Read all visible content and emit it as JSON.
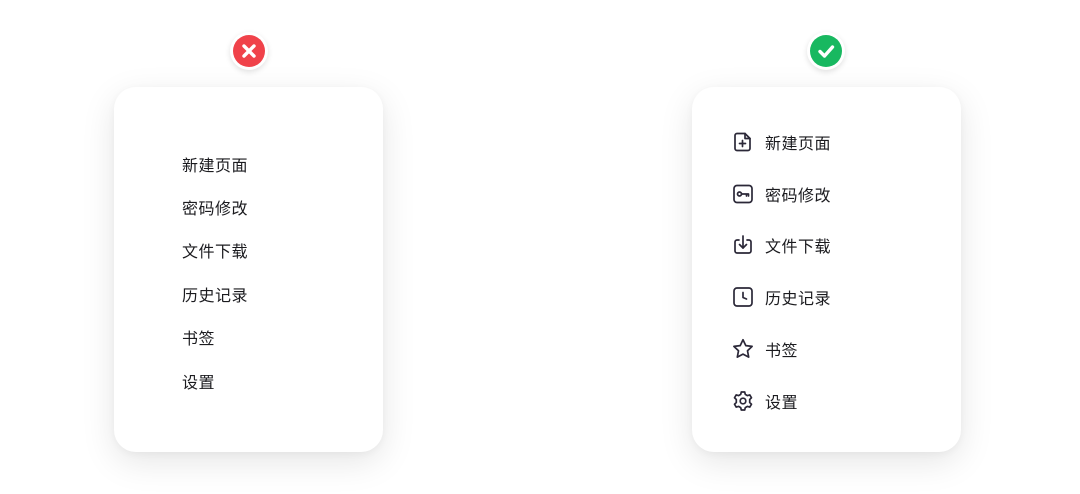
{
  "colors": {
    "bad": "#f0424a",
    "good": "#18b860",
    "icon_stroke": "#2b2838",
    "text": "#1b1b1f"
  },
  "bad_example": {
    "badge_icon": "close-icon",
    "items": [
      {
        "label": "新建页面"
      },
      {
        "label": "密码修改"
      },
      {
        "label": "文件下载"
      },
      {
        "label": "历史记录"
      },
      {
        "label": "书签"
      },
      {
        "label": "设置"
      }
    ]
  },
  "good_example": {
    "badge_icon": "check-icon",
    "items": [
      {
        "label": "新建页面",
        "icon": "new-page-icon"
      },
      {
        "label": "密码修改",
        "icon": "key-icon"
      },
      {
        "label": "文件下载",
        "icon": "download-icon"
      },
      {
        "label": "历史记录",
        "icon": "clock-icon"
      },
      {
        "label": "书签",
        "icon": "star-icon"
      },
      {
        "label": "设置",
        "icon": "gear-icon"
      }
    ]
  }
}
